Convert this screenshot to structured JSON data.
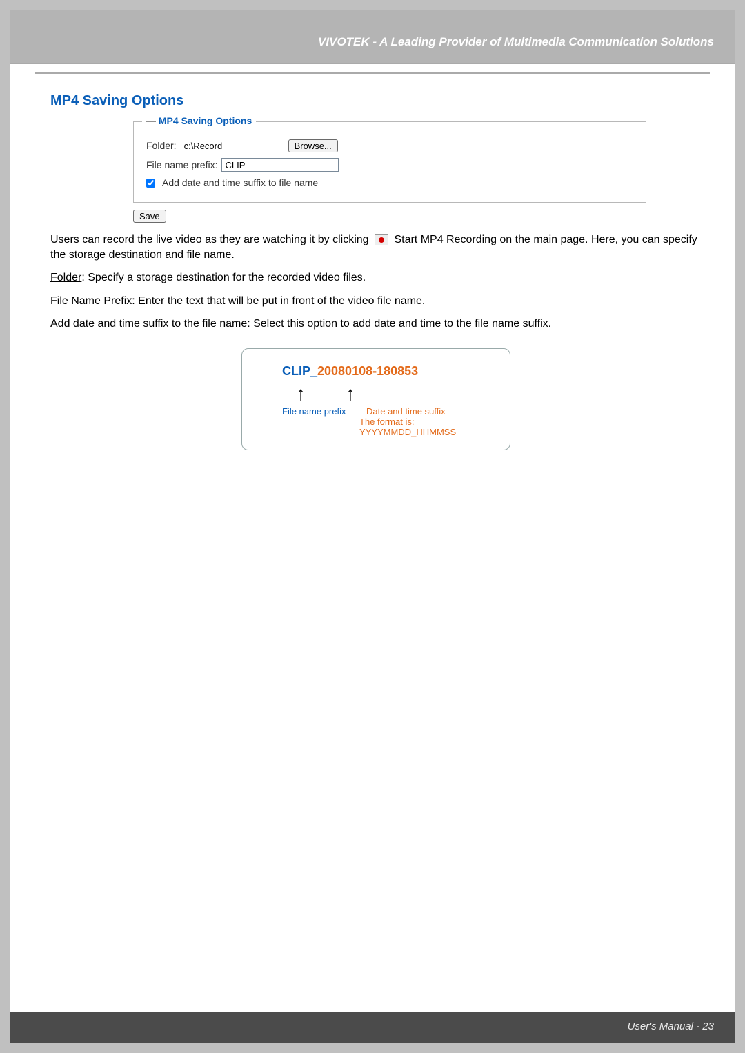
{
  "header": {
    "title": "VIVOTEK - A Leading Provider of Multimedia Communication Solutions"
  },
  "section": {
    "heading": "MP4 Saving Options"
  },
  "panel": {
    "legend": "MP4 Saving Options",
    "folder_label": "Folder:",
    "folder_value": "c:\\Record",
    "browse_label": "Browse...",
    "prefix_label": "File name prefix:",
    "prefix_value": "CLIP",
    "suffix_checkbox_label": "Add date and time suffix to file name",
    "suffix_checked": true,
    "save_label": "Save"
  },
  "body": {
    "p1_a": "Users can record the live video as they are watching it by clicking ",
    "p1_b": " Start MP4 Recording on the main page. Here, you can specify the storage destination and file name.",
    "p2_label": "Folder",
    "p2_text": ": Specify a storage destination for the recorded video files.",
    "p3_label": "File Name Prefix",
    "p3_text": ": Enter the text that will be put in front of the video file name.",
    "p4_label": "Add date and time suffix to the file name",
    "p4_text": ": Select this option to add date and time to the file name suffix."
  },
  "example": {
    "prefix_text": "CLIP_",
    "suffix_text": "20080108-180853",
    "arrow_glyph": "↑",
    "label_prefix": "File name prefix",
    "label_suffix": "Date and time suffix",
    "label_format": "The format is: YYYYMMDD_HHMMSS"
  },
  "footer": {
    "text": "User's Manual - 23"
  }
}
